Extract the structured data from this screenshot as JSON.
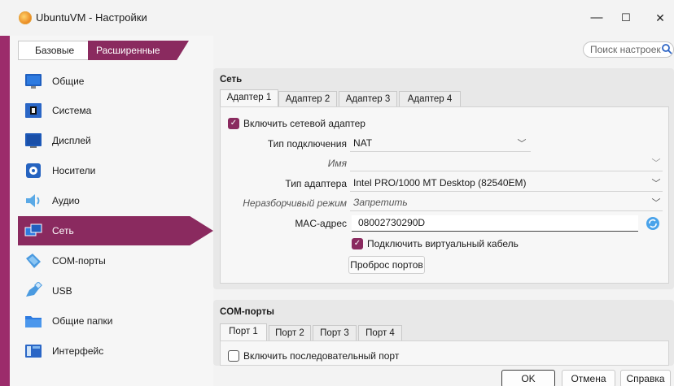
{
  "window": {
    "title": "UbuntuVM - Настройки",
    "minimize": "—",
    "maximize": "☐",
    "close": "✕"
  },
  "mode": {
    "basic": "Базовые",
    "advanced": "Расширенные",
    "selected": "advanced"
  },
  "search": {
    "placeholder": "Поиск настроек"
  },
  "sidebar": {
    "items": [
      {
        "label": "Общие",
        "icon": "monitor-icon"
      },
      {
        "label": "Система",
        "icon": "chip-icon"
      },
      {
        "label": "Дисплей",
        "icon": "display-icon"
      },
      {
        "label": "Носители",
        "icon": "disk-icon"
      },
      {
        "label": "Аудио",
        "icon": "speaker-icon"
      },
      {
        "label": "Сеть",
        "icon": "network-icon",
        "selected": true
      },
      {
        "label": "COM-порты",
        "icon": "serial-port-icon"
      },
      {
        "label": "USB",
        "icon": "usb-icon"
      },
      {
        "label": "Общие папки",
        "icon": "folder-icon"
      },
      {
        "label": "Интерфейс",
        "icon": "interface-icon"
      }
    ]
  },
  "network": {
    "title": "Сеть",
    "tabs": [
      "Адаптер 1",
      "Адаптер 2",
      "Адаптер 3",
      "Адаптер 4"
    ],
    "active_tab": 0,
    "enable_label": "Включить сетевой адаптер",
    "enable_checked": true,
    "attached_label": "Тип подключения",
    "attached_value": "NAT",
    "name_label": "Имя",
    "name_value": "",
    "adapter_type_label": "Тип адаптера",
    "adapter_type_value": "Intel PRO/1000 MT Desktop (82540EM)",
    "promisc_label": "Неразборчивый режим",
    "promisc_value": "Запретить",
    "mac_label": "MAC-адрес",
    "mac_value": "08002730290D",
    "cable_label": "Подключить виртуальный кабель",
    "cable_checked": true,
    "port_forwarding": "Проброс портов"
  },
  "com": {
    "title": "COM-порты",
    "tabs": [
      "Порт 1",
      "Порт 2",
      "Порт 3",
      "Порт 4"
    ],
    "active_tab": 0,
    "enable_label": "Включить последовательный порт",
    "enable_checked": false
  },
  "footer": {
    "ok": "OK",
    "cancel": "Отмена",
    "help": "Справка"
  },
  "colors": {
    "accent": "#8a2a5f",
    "strip": "#9c2c6b"
  }
}
